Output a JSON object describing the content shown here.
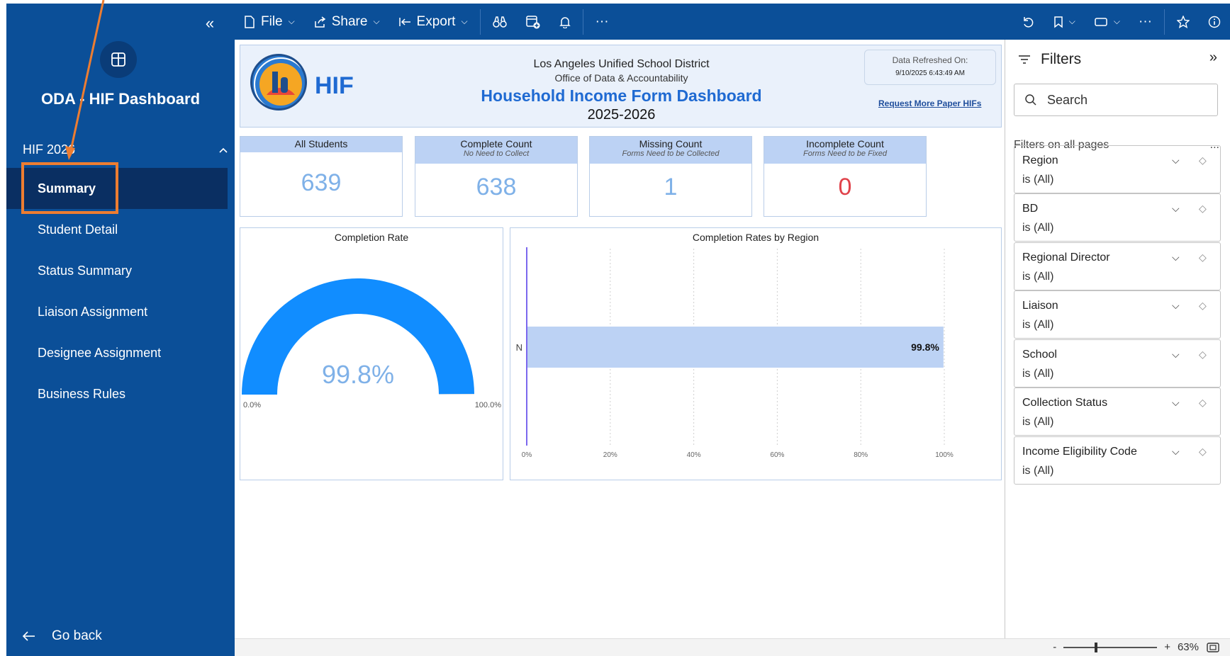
{
  "sidebar": {
    "collapse_icon": "«",
    "app_title": "ODA - HIF Dashboard",
    "section_label": "HIF 2026",
    "items": [
      {
        "label": "Summary",
        "active": true
      },
      {
        "label": "Student Detail"
      },
      {
        "label": "Status Summary"
      },
      {
        "label": "Liaison Assignment"
      },
      {
        "label": "Designee Assignment"
      },
      {
        "label": "Business Rules"
      }
    ],
    "go_back": "Go back"
  },
  "toolbar": {
    "file": "File",
    "share": "Share",
    "export": "Export",
    "more": "···"
  },
  "header": {
    "hif": "HIF",
    "district": "Los Angeles Unified School District",
    "office": "Office of Data & Accountability",
    "title": "Household Income Form Dashboard",
    "year": "2025-2026",
    "refresh_label": "Data Refreshed On:",
    "refresh_date": "9/10/2025 6:43:49 AM",
    "request_link": "Request More Paper HIFs"
  },
  "cards": [
    {
      "title": "All Students",
      "sub": "",
      "value": "639"
    },
    {
      "title": "Complete Count",
      "sub": "No Need to Collect",
      "value": "638"
    },
    {
      "title": "Missing Count",
      "sub": "Forms Need to be Collected",
      "value": "1"
    },
    {
      "title": "Incomplete Count",
      "sub": "Forms Need to be Fixed",
      "value": "0"
    }
  ],
  "chart_data": [
    {
      "type": "gauge",
      "title": "Completion Rate",
      "value": 99.8,
      "value_label": "99.8%",
      "min_label": "0.0%",
      "max_label": "100.0%",
      "color": "#118dff"
    },
    {
      "type": "bar",
      "title": "Completion Rates by Region",
      "orientation": "horizontal",
      "categories": [
        "N"
      ],
      "values": [
        99.8
      ],
      "data_labels": [
        "99.8%"
      ],
      "xlim": [
        0,
        100
      ],
      "xticks": [
        "0%",
        "20%",
        "40%",
        "60%",
        "80%",
        "100%"
      ],
      "bar_color": "#bcd2f4",
      "grid": true
    }
  ],
  "filters": {
    "title": "Filters",
    "search_placeholder": "Search",
    "all_pages": "Filters on all pages",
    "more": "...",
    "items": [
      {
        "name": "Region",
        "value": "is (All)"
      },
      {
        "name": "BD",
        "value": "is (All)"
      },
      {
        "name": "Regional Director",
        "value": "is (All)"
      },
      {
        "name": "Liaison",
        "value": "is (All)"
      },
      {
        "name": "School",
        "value": "is (All)"
      },
      {
        "name": "Collection Status",
        "value": "is (All)"
      },
      {
        "name": "Income Eligibility Code",
        "value": "is (All)"
      }
    ]
  },
  "statusbar": {
    "zoom_minus": "-",
    "zoom_plus": "+",
    "zoom_level": "63%",
    "zoom_fraction": 0.33
  },
  "colors": {
    "sidebar": "#0b4f98",
    "accent": "#1f6ad2",
    "annotation": "#ed7d31"
  }
}
